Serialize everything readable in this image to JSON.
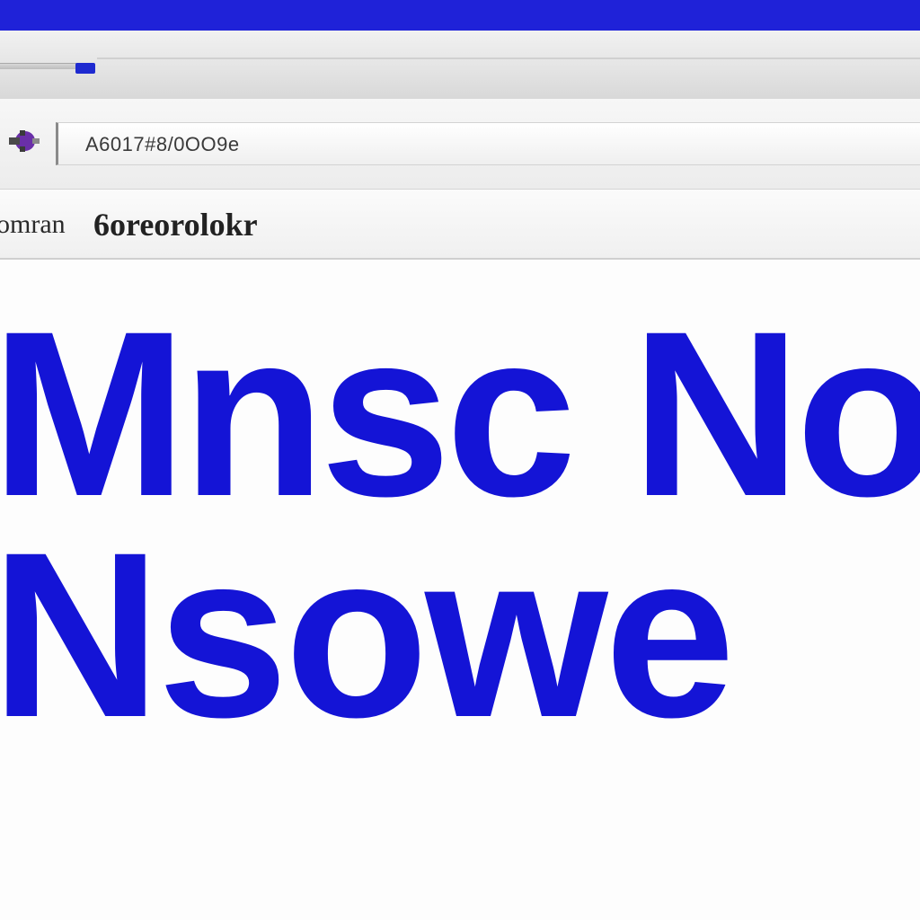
{
  "window": {
    "accent_color": "#1f22d8"
  },
  "toolbar": {
    "icon": "puzzle-extension-icon",
    "address_text": "A6017#8/0OO9e"
  },
  "bookmarks": {
    "item_a": "omran",
    "item_b": "6oreorolokr"
  },
  "content": {
    "line_1": "Mnsc No",
    "line_2": "Nsowe",
    "text_color": "#1414d6"
  }
}
